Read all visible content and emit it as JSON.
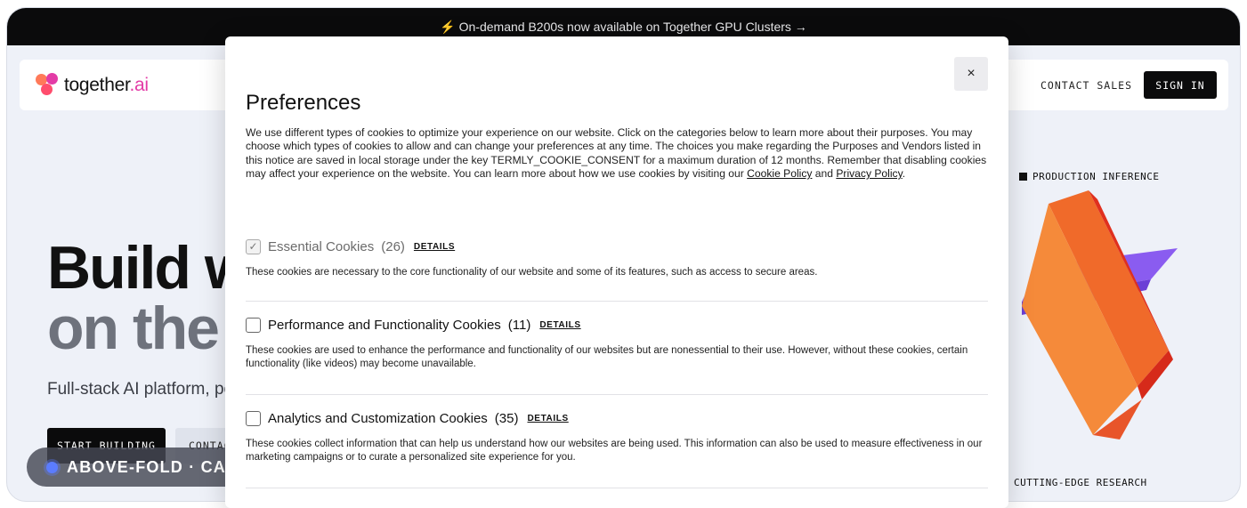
{
  "announcement": {
    "icon": "⚡",
    "text": "On-demand B200s now available on Together GPU Clusters →"
  },
  "nav": {
    "logo_text_a": "together",
    "logo_text_b": ".ai",
    "contact_sales": "CONTACT SALES",
    "sign_in": "SIGN IN"
  },
  "hero": {
    "title_line1": "Build wh",
    "title_line2": "on the A",
    "subtitle": "Full-stack AI platform, powe",
    "start_building": "START BUILDING",
    "contact": "CONTACT"
  },
  "side": {
    "production_inference": "PRODUCTION INFERENCE",
    "cutting_edge_research": "CUTTING-EDGE RESEARCH"
  },
  "badge": {
    "text": "ABOVE-FOLD · CAPT URE RÉELLE"
  },
  "modal": {
    "close_glyph": "×",
    "title": "Preferences",
    "intro": "We use different types of cookies to optimize your experience on our website. Click on the categories below to learn more about their purposes. You may choose which types of cookies to allow and can change your preferences at any time. The choices you make regarding the Purposes and Vendors listed in this notice are saved in local storage under the key TERMLY_COOKIE_CONSENT for a maximum duration of 12 months. Remember that disabling cookies may affect your experience on the website. You can learn more about how we use cookies by visiting our",
    "cookie_policy": "Cookie Policy",
    "and": "and",
    "privacy_policy": "Privacy Policy",
    "period": ".",
    "categories": [
      {
        "title": "Essential Cookies",
        "count": "(26)",
        "details": "DETAILS",
        "checked": true,
        "description": "These cookies are necessary to the core functionality of our website and some of its features, such as access to secure areas."
      },
      {
        "title": "Performance and Functionality Cookies",
        "count": "(11)",
        "details": "DETAILS",
        "checked": false,
        "description": "These cookies are used to enhance the performance and functionality of our websites but are nonessential to their use. However, without these cookies, certain functionality (like videos) may become unavailable."
      },
      {
        "title": "Analytics and Customization Cookies",
        "count": "(35)",
        "details": "DETAILS",
        "checked": false,
        "description": "These cookies collect information that can help us understand how our websites are being used. This information can also be used to measure effectiveness in our marketing campaigns or to curate a personalized site experience for you."
      }
    ],
    "check_glyph": "✓"
  }
}
